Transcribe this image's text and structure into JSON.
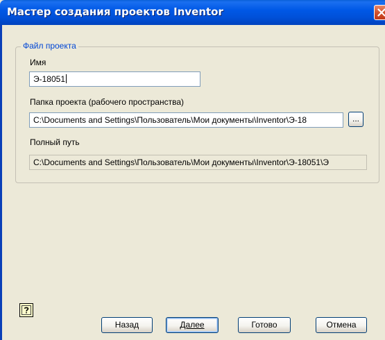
{
  "window": {
    "title": "Мастер создания проектов Inventor"
  },
  "group": {
    "legend": "Файл проекта"
  },
  "fields": {
    "name_label": "Имя",
    "name_value": "Э-18051",
    "folder_label": "Папка проекта (рабочего пространства)",
    "folder_value": "C:\\Documents and Settings\\Пользователь\\Мои документы\\Inventor\\Э-18",
    "browse_label": "...",
    "fullpath_label": "Полный путь",
    "fullpath_value": "C:\\Documents and Settings\\Пользователь\\Мои документы\\Inventor\\Э-18051\\Э"
  },
  "buttons": {
    "back_label": "Назад",
    "next_label": "Далее",
    "finish_label": "Готово",
    "cancel_label": "Отмена"
  },
  "icons": {
    "close": "close-icon",
    "help": "help-icon"
  },
  "colors": {
    "titlebar": "#0054e3",
    "legend": "#0046d5",
    "window_bg": "#ece9d8",
    "close": "#d3522e"
  }
}
